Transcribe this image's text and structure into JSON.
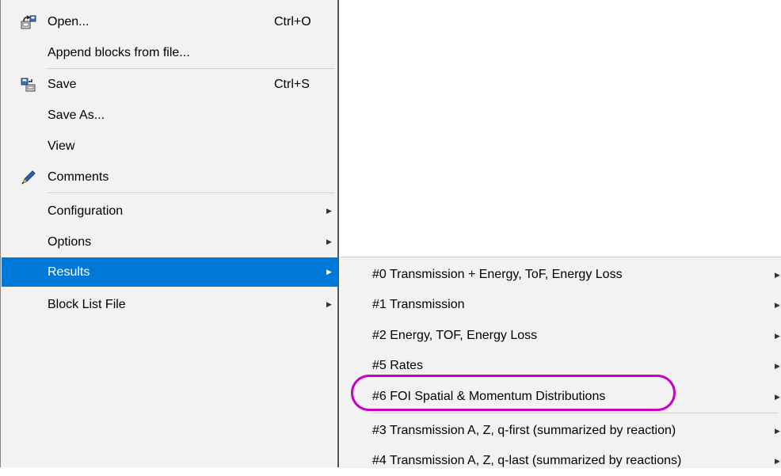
{
  "menu": {
    "items": [
      {
        "label": "Open...",
        "shortcut": "Ctrl+O",
        "icon": "open-icon"
      },
      {
        "label": "Append blocks from file..."
      },
      {
        "label": "Save",
        "shortcut": "Ctrl+S",
        "icon": "save-icon"
      },
      {
        "label": "Save As..."
      },
      {
        "label": "View"
      },
      {
        "label": "Comments",
        "icon": "pen-icon"
      },
      {
        "label": "Configuration"
      },
      {
        "label": "Options"
      },
      {
        "label": "Results",
        "selected": true
      },
      {
        "label": "Block List File"
      }
    ]
  },
  "submenu": {
    "items": [
      {
        "label": "#0  Transmission + Energy, ToF, Energy Loss"
      },
      {
        "label": "#1  Transmission"
      },
      {
        "label": "#2  Energy, TOF, Energy Loss"
      },
      {
        "label": "#5  Rates"
      },
      {
        "label": "#6  FOI Spatial & Momentum Distributions",
        "annotated": true
      },
      {
        "label": "#3  Transmission A, Z, q-first (summarized by reaction)"
      },
      {
        "label": "#4  Transmission A, Z, q-last (summarized by reactions)"
      }
    ]
  },
  "colors": {
    "highlight": "#0078d7",
    "menu_bg": "#f2f2f2",
    "annotation": "#c800c8"
  }
}
